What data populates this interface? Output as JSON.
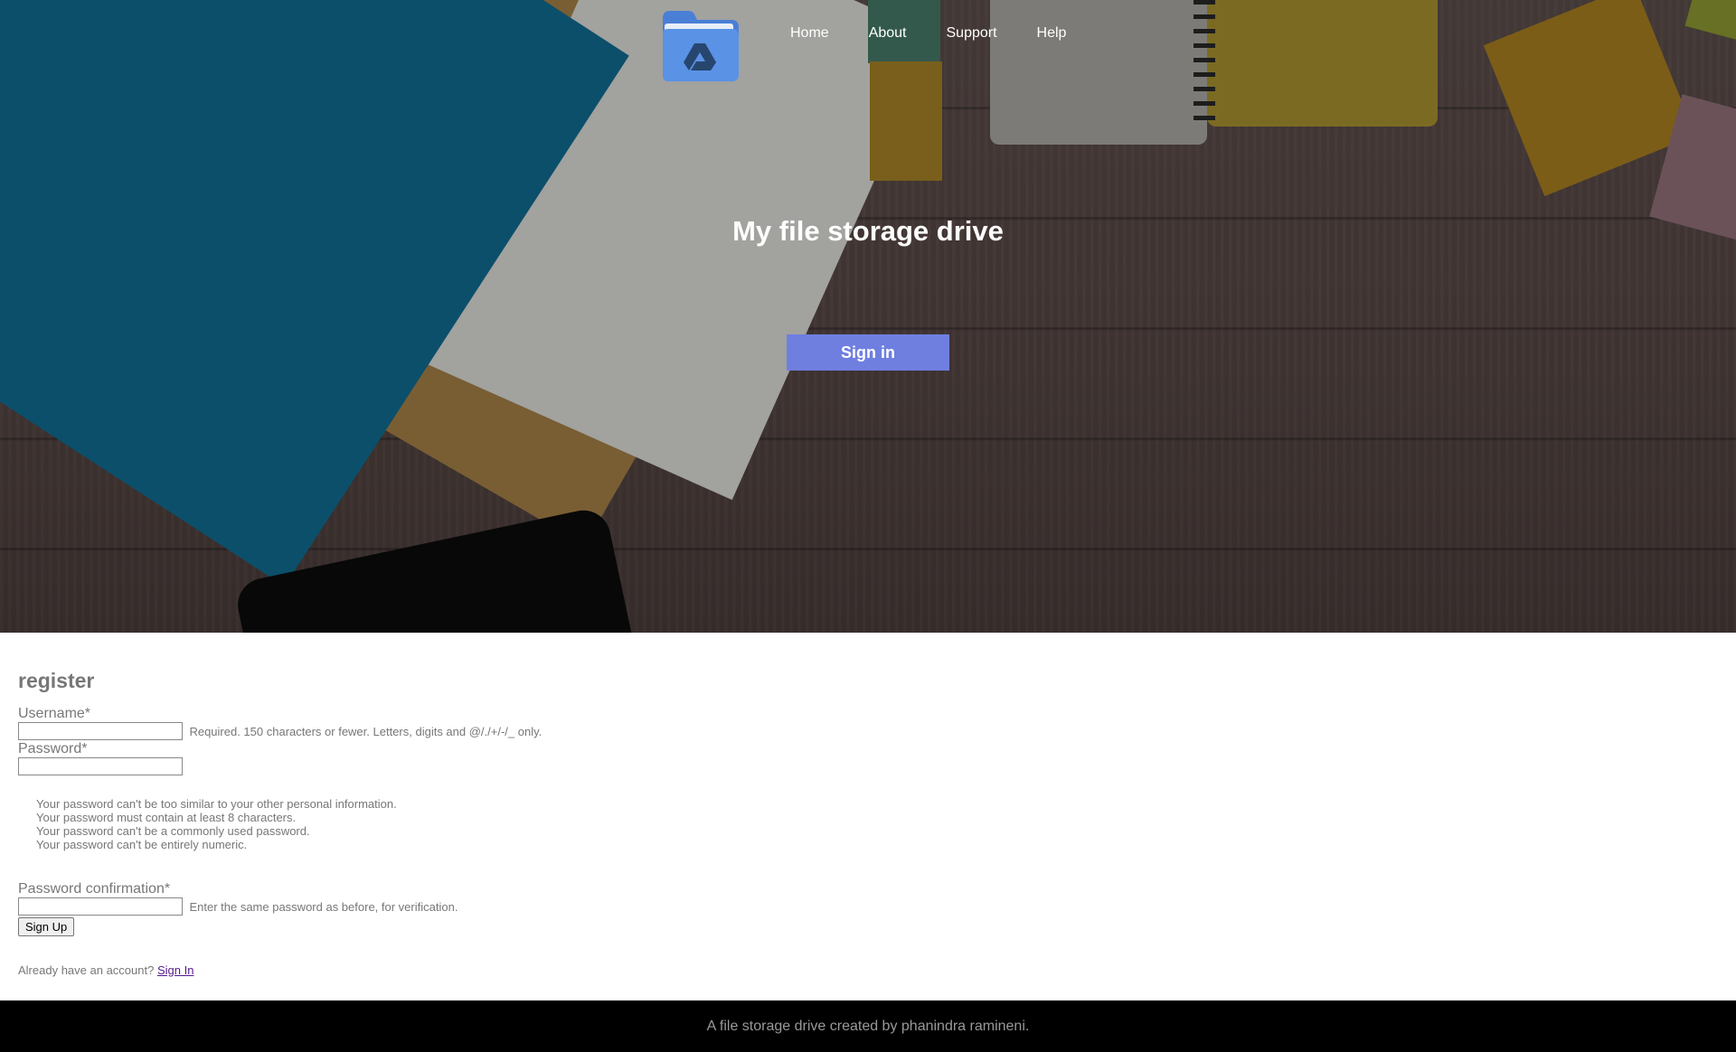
{
  "nav": {
    "logo_icon": "drive-folder-icon",
    "items": [
      "Home",
      "About",
      "Support",
      "Help"
    ]
  },
  "hero": {
    "title": "My file storage drive",
    "signin_label": "Sign in",
    "button_color": "#6f7fe0"
  },
  "register": {
    "heading": "register",
    "username_label": "Username*",
    "username_help": "Required. 150 characters or fewer. Letters, digits and @/./+/-/_ only.",
    "password_label": "Password*",
    "password_rules": [
      "Your password can't be too similar to your other personal information.",
      "Your password must contain at least 8 characters.",
      "Your password can't be a commonly used password.",
      "Your password can't be entirely numeric."
    ],
    "confirm_label": "Password confirmation*",
    "confirm_help": "Enter the same password as before, for verification.",
    "signup_label": "Sign Up",
    "already_text": "Already have an account?",
    "signin_link": "Sign In"
  },
  "footer": {
    "text": "A file storage drive created by phanindra ramineni."
  }
}
